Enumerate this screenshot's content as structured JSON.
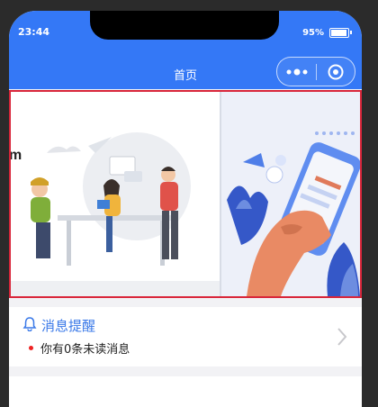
{
  "status_bar": {
    "time": "23:44",
    "battery": "95%"
  },
  "nav": {
    "title": "首页"
  },
  "banner": {
    "partial_text": "m",
    "slides": [
      "team-meeting-illustration",
      "phone-in-hand-illustration"
    ]
  },
  "notice": {
    "title": "消息提醒",
    "message": "你有0条未读消息"
  },
  "icons": {
    "bell": "bell-icon",
    "more": "more-dots-icon",
    "close": "target-close-icon",
    "chevron": "chevron-right-icon"
  },
  "colors": {
    "header": "#3478f6",
    "accent": "#3a79e8",
    "banner_border": "#d9263a",
    "unread_dot": "#e22222"
  }
}
